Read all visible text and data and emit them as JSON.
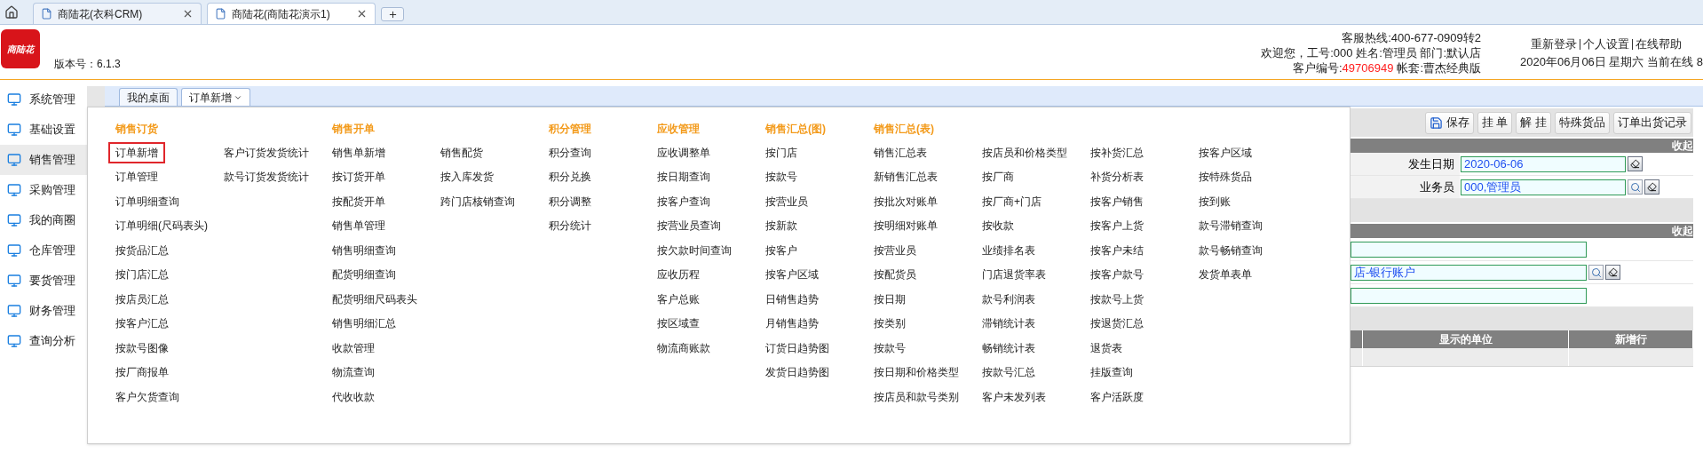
{
  "browser_tabs": [
    {
      "label": "商陆花(衣科CRM)",
      "selected": false
    },
    {
      "label": "商陆花(商陆花演示1)",
      "selected": true
    }
  ],
  "header": {
    "logo_text": "商陆花",
    "version": "版本号：6.1.3",
    "hotline": "客服热线:400-677-0909转2",
    "welcome": "欢迎您，工号:000 姓名:管理员 部门:默认店",
    "customer_label": "客户编号:",
    "customer_number": "49706949",
    "account": "帐套:曹杰经典版",
    "links": [
      "重新登录",
      "个人设置",
      "在线帮助"
    ],
    "date_line": "2020年06月06日 星期六 当前在线 8"
  },
  "sidebar": {
    "items": [
      {
        "label": "系统管理",
        "selected": false
      },
      {
        "label": "基础设置",
        "selected": false
      },
      {
        "label": "销售管理",
        "selected": true
      },
      {
        "label": "采购管理",
        "selected": false
      },
      {
        "label": "我的商圈",
        "selected": false
      },
      {
        "label": "仓库管理",
        "selected": false
      },
      {
        "label": "要货管理",
        "selected": false
      },
      {
        "label": "财务管理",
        "selected": false
      },
      {
        "label": "查询分析",
        "selected": false
      }
    ]
  },
  "page_tabs": [
    {
      "label": "我的桌面",
      "selected": false,
      "has_dropdown": false
    },
    {
      "label": "订单新增",
      "selected": true,
      "has_dropdown": true
    }
  ],
  "menu": {
    "groups": [
      {
        "title": "销售订货",
        "columns": [
          [
            {
              "label": "订单新增",
              "selected": true
            },
            {
              "label": "订单管理",
              "selected": false
            },
            {
              "label": "订单明细查询",
              "selected": false
            },
            {
              "label": "订单明细(尺码表头)",
              "selected": false
            },
            {
              "label": "按货品汇总",
              "selected": false
            },
            {
              "label": "按门店汇总",
              "selected": false
            },
            {
              "label": "按店员汇总",
              "selected": false
            },
            {
              "label": "按客户汇总",
              "selected": false
            },
            {
              "label": "按款号图像",
              "selected": false
            },
            {
              "label": "按厂商报单",
              "selected": false
            },
            {
              "label": "客户欠货查询",
              "selected": false
            }
          ],
          [
            {
              "label": "客户订货发货统计",
              "selected": false
            },
            {
              "label": "款号订货发货统计",
              "selected": false
            }
          ]
        ]
      },
      {
        "title": "销售开单",
        "columns": [
          [
            {
              "label": "销售单新增",
              "selected": false
            },
            {
              "label": "按订货开单",
              "selected": false
            },
            {
              "label": "按配货开单",
              "selected": false
            },
            {
              "label": "销售单管理",
              "selected": false
            },
            {
              "label": "销售明细查询",
              "selected": false
            },
            {
              "label": "配货明细查询",
              "selected": false
            },
            {
              "label": "配货明细尺码表头",
              "selected": false
            },
            {
              "label": "销售明细汇总",
              "selected": false
            },
            {
              "label": "收款管理",
              "selected": false
            },
            {
              "label": "物流查询",
              "selected": false
            },
            {
              "label": "代收收款",
              "selected": false
            }
          ],
          [
            {
              "label": "销售配货",
              "selected": false
            },
            {
              "label": "按入库发货",
              "selected": false
            },
            {
              "label": "跨门店核销查询",
              "selected": false
            }
          ]
        ]
      },
      {
        "title": "积分管理",
        "columns": [
          [
            {
              "label": "积分查询",
              "selected": false
            },
            {
              "label": "积分兑换",
              "selected": false
            },
            {
              "label": "积分调整",
              "selected": false
            },
            {
              "label": "积分统计",
              "selected": false
            }
          ]
        ]
      },
      {
        "title": "应收管理",
        "columns": [
          [
            {
              "label": "应收调整单",
              "selected": false
            },
            {
              "label": "按日期查询",
              "selected": false
            },
            {
              "label": "按客户查询",
              "selected": false
            },
            {
              "label": "按营业员查询",
              "selected": false
            },
            {
              "label": "按欠款时间查询",
              "selected": false
            },
            {
              "label": "应收历程",
              "selected": false
            },
            {
              "label": "客户总账",
              "selected": false
            },
            {
              "label": "按区域查",
              "selected": false
            },
            {
              "label": "物流商账款",
              "selected": false
            }
          ]
        ]
      },
      {
        "title": "销售汇总(图)",
        "columns": [
          [
            {
              "label": "按门店",
              "selected": false
            },
            {
              "label": "按款号",
              "selected": false
            },
            {
              "label": "按营业员",
              "selected": false
            },
            {
              "label": "按新款",
              "selected": false
            },
            {
              "label": "按客户",
              "selected": false
            },
            {
              "label": "按客户区域",
              "selected": false
            },
            {
              "label": "日销售趋势",
              "selected": false
            },
            {
              "label": "月销售趋势",
              "selected": false
            },
            {
              "label": "订货日趋势图",
              "selected": false
            },
            {
              "label": "发货日趋势图",
              "selected": false
            }
          ]
        ]
      },
      {
        "title": "销售汇总(表)",
        "columns": [
          [
            {
              "label": "销售汇总表",
              "selected": false
            },
            {
              "label": "新销售汇总表",
              "selected": false
            },
            {
              "label": "按批次对账单",
              "selected": false
            },
            {
              "label": "按明细对账单",
              "selected": false
            },
            {
              "label": "按营业员",
              "selected": false
            },
            {
              "label": "按配货员",
              "selected": false
            },
            {
              "label": "按日期",
              "selected": false
            },
            {
              "label": "按类别",
              "selected": false
            },
            {
              "label": "按款号",
              "selected": false
            },
            {
              "label": "按日期和价格类型",
              "selected": false
            },
            {
              "label": "按店员和款号类别",
              "selected": false
            }
          ],
          [
            {
              "label": "按店员和价格类型",
              "selected": false
            },
            {
              "label": "按厂商",
              "selected": false
            },
            {
              "label": "按厂商+门店",
              "selected": false
            },
            {
              "label": "按收款",
              "selected": false
            },
            {
              "label": "业绩排名表",
              "selected": false
            },
            {
              "label": "门店退货率表",
              "selected": false
            },
            {
              "label": "款号利润表",
              "selected": false
            },
            {
              "label": "滞销统计表",
              "selected": false
            },
            {
              "label": "畅销统计表",
              "selected": false
            },
            {
              "label": "按款号汇总",
              "selected": false
            },
            {
              "label": "客户未发列表",
              "selected": false
            }
          ],
          [
            {
              "label": "按补货汇总",
              "selected": false
            },
            {
              "label": "补货分析表",
              "selected": false
            },
            {
              "label": "按客户销售",
              "selected": false
            },
            {
              "label": "按客户上货",
              "selected": false
            },
            {
              "label": "按客户未结",
              "selected": false
            },
            {
              "label": "按客户款号",
              "selected": false
            },
            {
              "label": "按款号上货",
              "selected": false
            },
            {
              "label": "按退货汇总",
              "selected": false
            },
            {
              "label": "退货表",
              "selected": false
            },
            {
              "label": "挂版查询",
              "selected": false
            },
            {
              "label": "客户活跃度",
              "selected": false
            }
          ],
          [
            {
              "label": "按客户区域",
              "selected": false
            },
            {
              "label": "按特殊货品",
              "selected": false
            },
            {
              "label": "按到账",
              "selected": false
            },
            {
              "label": "款号滞销查询",
              "selected": false
            },
            {
              "label": "款号畅销查询",
              "selected": false
            },
            {
              "label": "发货单表单",
              "selected": false
            }
          ]
        ]
      }
    ]
  },
  "form": {
    "toolbar": [
      {
        "label": "保存",
        "kind": "save"
      },
      {
        "label": "挂 单",
        "kind": "plain"
      },
      {
        "label": "解 挂",
        "kind": "plain"
      },
      {
        "label": "特殊货品",
        "kind": "plain"
      },
      {
        "label": "订单出货记录",
        "kind": "plain"
      }
    ],
    "sections": [
      {
        "collapse_label": "收起",
        "fields": [
          {
            "kind": "labeled",
            "label": "发生日期",
            "value": "2020-06-06",
            "search_button": false,
            "edit_button": true
          },
          {
            "kind": "labeled",
            "label": "业务员",
            "value": "000,管理员",
            "search_button": true,
            "edit_button": true
          }
        ]
      },
      {
        "collapse_label": "收起",
        "fields": [
          {
            "kind": "wide"
          },
          {
            "kind": "wide",
            "value": "店-银行账户",
            "search_button": true,
            "edit_button": true
          },
          {
            "kind": "wide"
          }
        ]
      }
    ],
    "table": {
      "columns": [
        "显示的单位",
        "新增行"
      ]
    }
  }
}
